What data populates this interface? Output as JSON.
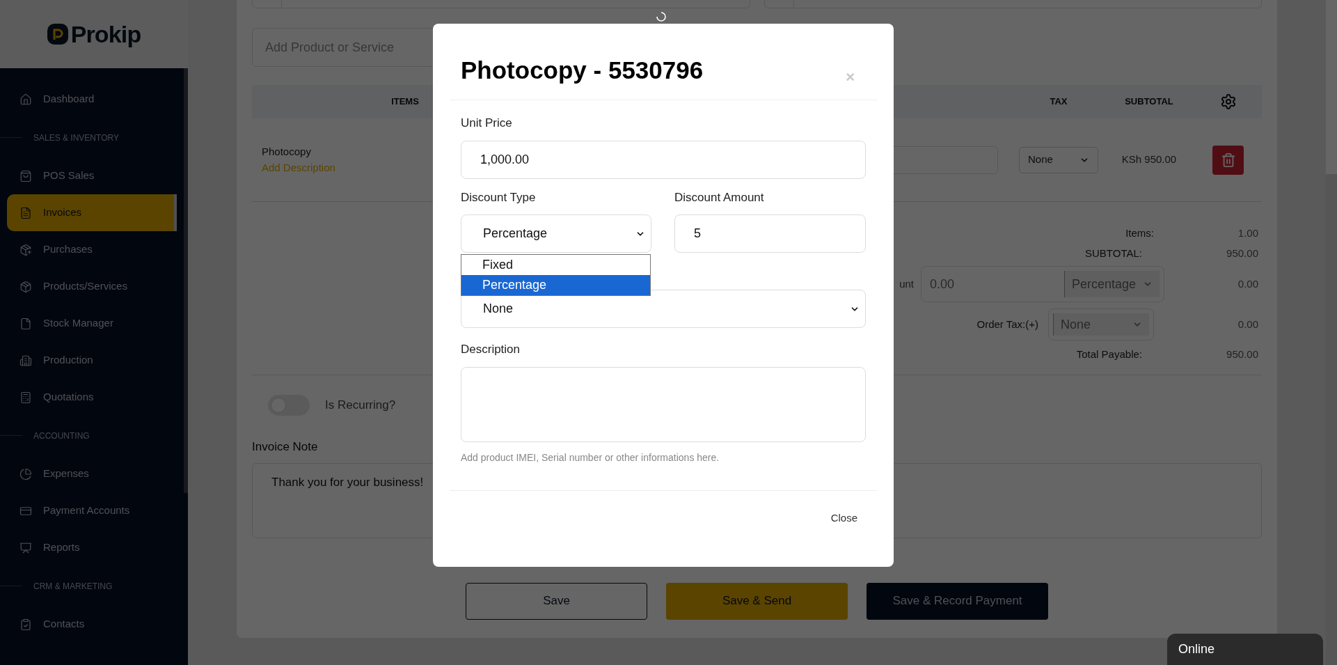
{
  "sidebar": {
    "logo": "Prokip",
    "items": [
      {
        "kind": "item",
        "label": "Dashboard",
        "selected": false
      },
      {
        "kind": "section",
        "label": "SALES & INVENTORY"
      },
      {
        "kind": "item",
        "label": "POS Sales",
        "selected": false
      },
      {
        "kind": "item",
        "label": "Invoices",
        "selected": true
      },
      {
        "kind": "item",
        "label": "Purchases",
        "selected": false
      },
      {
        "kind": "item",
        "label": "Products/Services",
        "selected": false
      },
      {
        "kind": "item",
        "label": "Stock Manager",
        "selected": false
      },
      {
        "kind": "item",
        "label": "Production",
        "selected": false
      },
      {
        "kind": "item",
        "label": "Quotations",
        "selected": false
      },
      {
        "kind": "section",
        "label": "ACCOUNTING"
      },
      {
        "kind": "item",
        "label": "Expenses",
        "selected": false
      },
      {
        "kind": "item",
        "label": "Payment Accounts",
        "selected": false
      },
      {
        "kind": "item",
        "label": "Reports",
        "selected": false
      },
      {
        "kind": "section",
        "label": "CRM & MARKETING"
      },
      {
        "kind": "item",
        "label": "Contacts",
        "selected": false
      }
    ]
  },
  "invoice": {
    "product_search": {
      "placeholder": "Add Product or Service"
    },
    "table": {
      "columns": [
        "ITEMS",
        "TAX",
        "SUBTOTAL"
      ],
      "rows": [
        {
          "name": "Photocopy",
          "link": "Add Description",
          "tax": "None",
          "subtotal": "KSh 950.00"
        }
      ]
    },
    "totals": {
      "items_label": "Items:",
      "items_value": "1.00",
      "subtotal_label": "SUBTOTAL:",
      "subtotal_value": "950.00",
      "discount_label": "unt",
      "discount_input": "0.00",
      "discount_type": "Percentage",
      "discount_value": "0.00",
      "tax_label": "Order Tax:(+)",
      "tax_select": "None",
      "tax_value": "0.00",
      "total_label": "Total Payable:",
      "total_value": "950.00"
    },
    "recurring": {
      "label": "Is Recurring?",
      "on": false
    },
    "note": {
      "label": "Invoice Note",
      "value": "Thank you for your business!"
    },
    "buttons": [
      {
        "kind": "outline",
        "label": "Save"
      },
      {
        "kind": "primary",
        "label": "Save & Send"
      },
      {
        "kind": "dark",
        "label": "Save & Record Payment"
      }
    ]
  },
  "modal": {
    "title": "Photocopy - 5530796",
    "close_symbol": "×",
    "unit_price": {
      "label": "Unit Price",
      "value": "1,000.00"
    },
    "discount_type": {
      "label": "Discount Type",
      "value": "Percentage",
      "options": [
        {
          "label": "Fixed",
          "selected": false
        },
        {
          "label": "Percentage",
          "selected": true
        }
      ]
    },
    "discount_amount": {
      "label": "Discount Amount",
      "value": "5"
    },
    "tax": {
      "value": "None"
    },
    "description": {
      "label": "Description",
      "help": "Add product IMEI, Serial number or other informations here."
    },
    "footer_button": "Close"
  },
  "status": "Online"
}
